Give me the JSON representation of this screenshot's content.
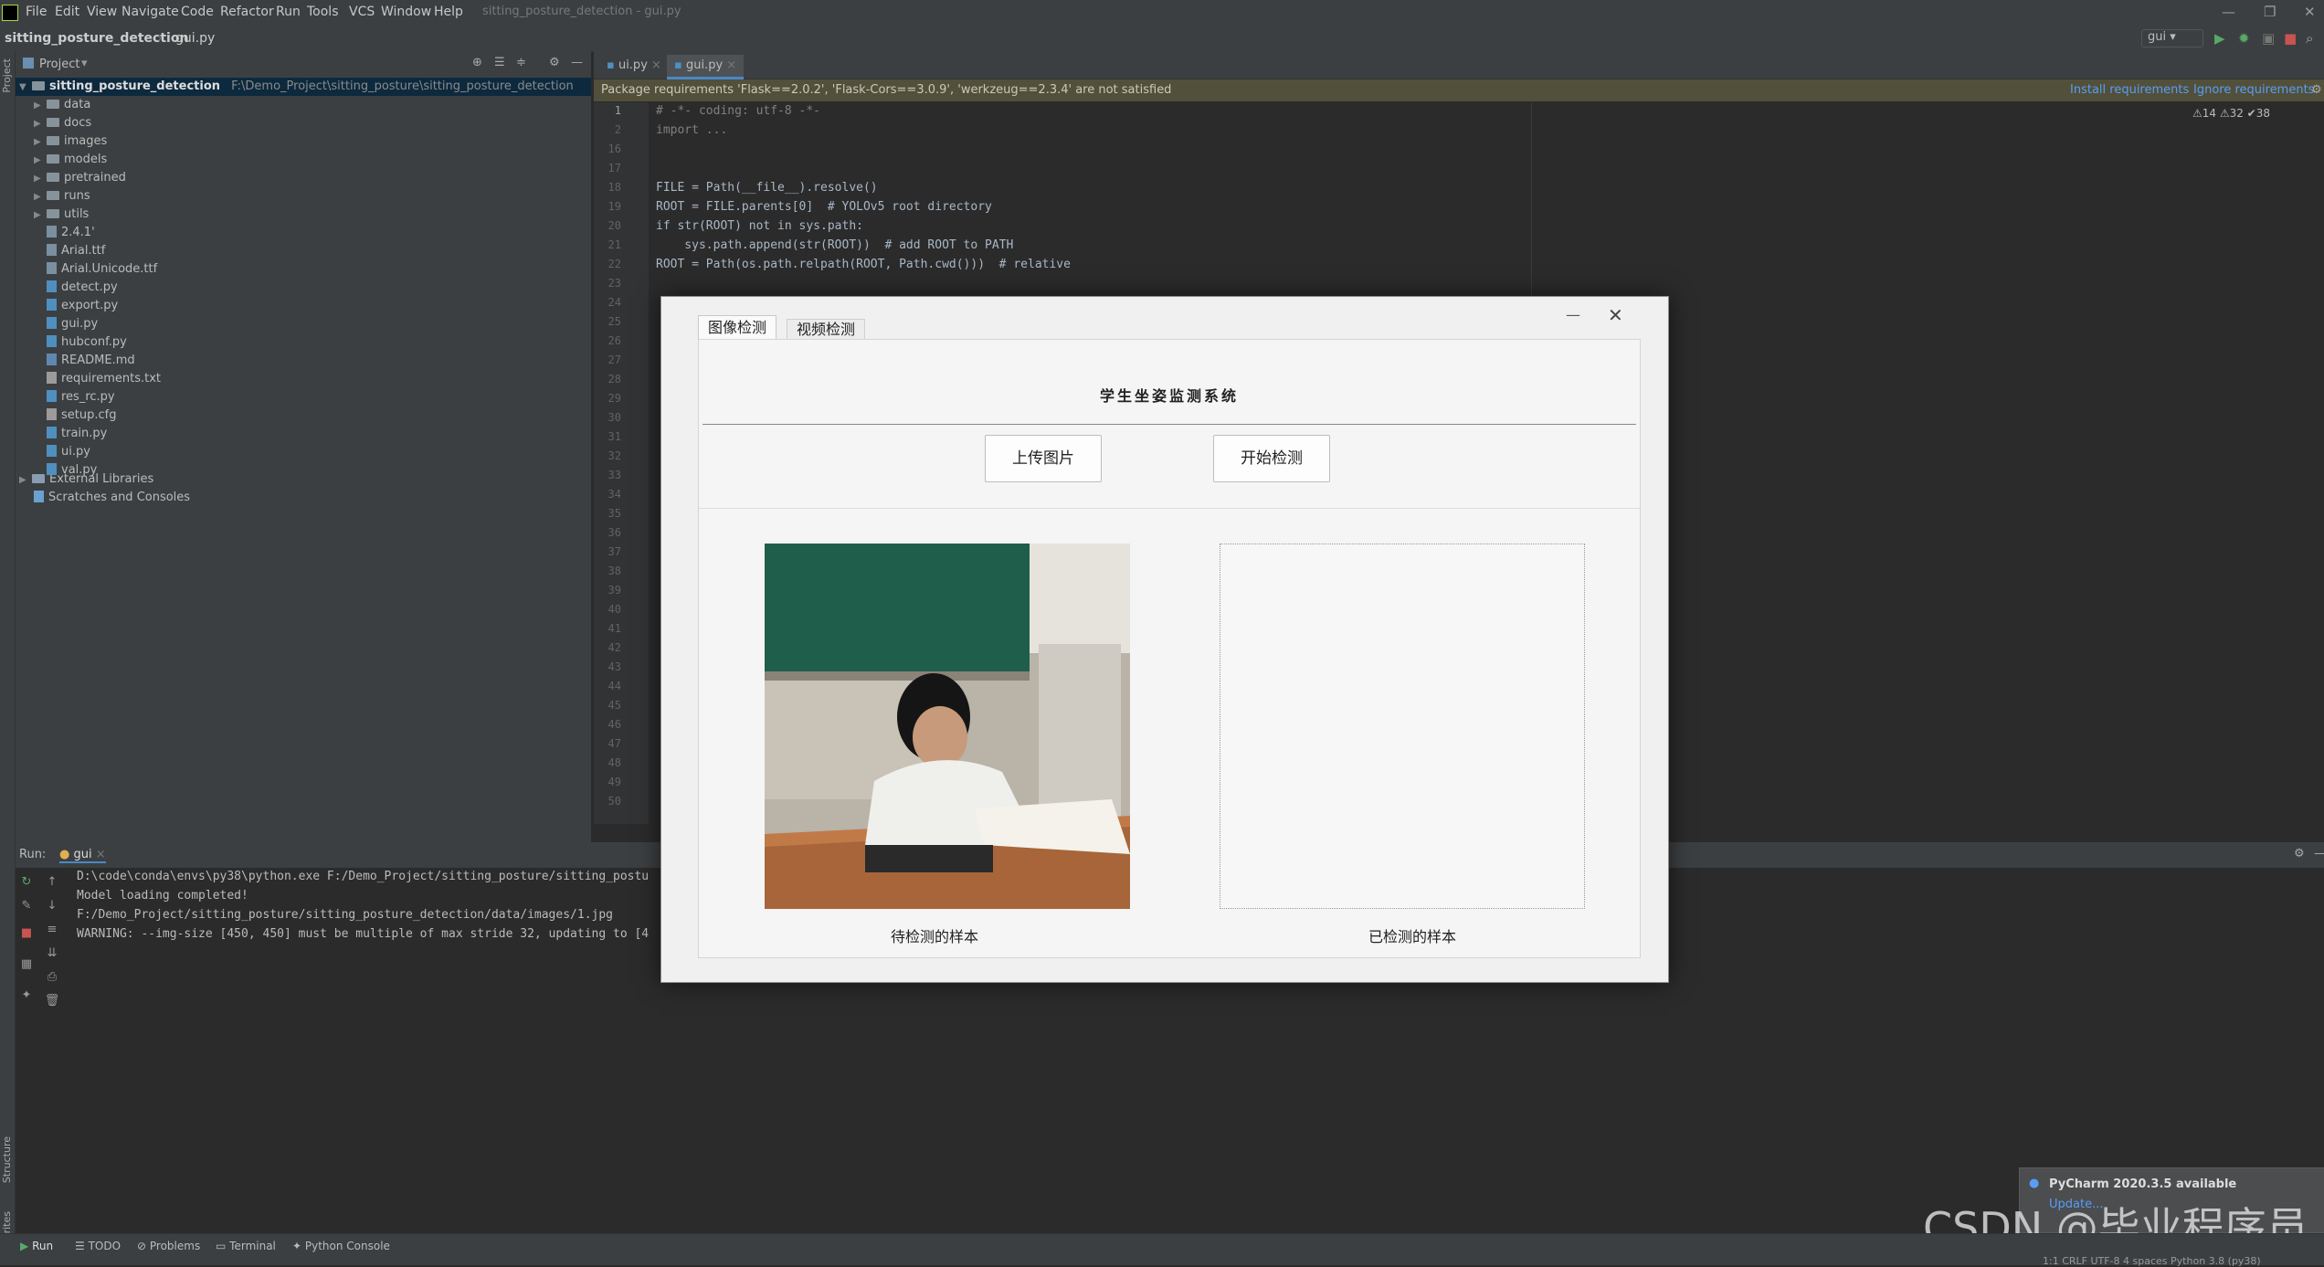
{
  "menu": {
    "items": [
      "File",
      "Edit",
      "View",
      "Navigate",
      "Code",
      "Refactor",
      "Run",
      "Tools",
      "VCS",
      "Window",
      "Help"
    ],
    "window_title": "sitting_posture_detection - gui.py"
  },
  "navbar": {
    "project": "sitting_posture_detection",
    "file": "gui.py",
    "run_config": "gui"
  },
  "project_panel": {
    "title": "Project",
    "root_name": "sitting_posture_detection",
    "root_path": "F:\\Demo_Project\\sitting_posture\\sitting_posture_detection",
    "tree": [
      {
        "label": "data",
        "type": "folder"
      },
      {
        "label": "docs",
        "type": "folder"
      },
      {
        "label": "images",
        "type": "folder"
      },
      {
        "label": "models",
        "type": "folder"
      },
      {
        "label": "pretrained",
        "type": "folder"
      },
      {
        "label": "runs",
        "type": "folder"
      },
      {
        "label": "utils",
        "type": "folder"
      },
      {
        "label": "2.4.1'",
        "type": "file"
      },
      {
        "label": "Arial.ttf",
        "type": "file"
      },
      {
        "label": "Arial.Unicode.ttf",
        "type": "file"
      },
      {
        "label": "detect.py",
        "type": "file"
      },
      {
        "label": "export.py",
        "type": "file"
      },
      {
        "label": "gui.py",
        "type": "file"
      },
      {
        "label": "hubconf.py",
        "type": "file"
      },
      {
        "label": "README.md",
        "type": "file"
      },
      {
        "label": "requirements.txt",
        "type": "file"
      },
      {
        "label": "res_rc.py",
        "type": "file"
      },
      {
        "label": "setup.cfg",
        "type": "file"
      },
      {
        "label": "train.py",
        "type": "file"
      },
      {
        "label": "ui.py",
        "type": "file"
      },
      {
        "label": "val.py",
        "type": "file"
      }
    ],
    "external_libraries": "External Libraries",
    "scratches": "Scratches and Consoles"
  },
  "editor": {
    "tabs": [
      "ui.py",
      "gui.py"
    ],
    "banner_text": "Package requirements 'Flask==2.0.2', 'Flask-Cors==3.0.9', 'werkzeug==2.3.4' are not satisfied",
    "banner_install": "Install requirements",
    "banner_ignore": "Ignore requirements",
    "inspection": "⚠14  ⚠32  ✔38",
    "line_numbers": [
      "1",
      "2",
      "16",
      "17",
      "18",
      "19",
      "20",
      "21",
      "22",
      "23",
      "24",
      "25",
      "26",
      "27",
      "28",
      "29",
      "30",
      "31",
      "32",
      "33",
      "34",
      "35",
      "36",
      "37",
      "38",
      "39",
      "40",
      "41",
      "42",
      "43",
      "44",
      "45",
      "46",
      "47",
      "48",
      "49",
      "50"
    ],
    "code_lines": [
      "# -*- coding: utf-8 -*-",
      "import ...",
      "FILE = Path(__file__).resolve()",
      "ROOT = FILE.parents[0]  # YOLOv5 root directory",
      "if str(ROOT) not in sys.path:",
      "    sys.path.append(str(ROOT))  # add ROOT to PATH",
      "ROOT = Path(os.path.relpath(ROOT, Path.cwd()))  # relative"
    ]
  },
  "run_panel": {
    "label": "Run:",
    "tab": "gui",
    "lines": [
      "D:\\code\\conda\\envs\\py38\\python.exe F:/Demo_Project/sitting_posture/sitting_postu",
      "Model loading completed!",
      "F:/Demo_Project/sitting_posture/sitting_posture_detection/data/images/1.jpg",
      "WARNING: --img-size [450, 450] must be multiple of max stride 32, updating to [4"
    ]
  },
  "bottom_tabs": [
    "Run",
    "TODO",
    "Problems",
    "Terminal",
    "Python Console"
  ],
  "status_bar": "1:1   CRLF   UTF-8   4 spaces   Python 3.8 (py38)",
  "notification": {
    "title": "PyCharm 2020.3.5 available",
    "link": "Update..."
  },
  "watermark": "CSDN @毕业程序员",
  "side_labels": [
    "Project",
    "Structure",
    "Favorites"
  ],
  "dialog": {
    "tabs": [
      "图像检测",
      "视频检测"
    ],
    "title": "学生坐姿监测系统",
    "upload_button": "上传图片",
    "detect_button": "开始检测",
    "caption_left": "待检测的样本",
    "caption_right": "已检测的样本",
    "minimize": "—",
    "close": "✕"
  }
}
